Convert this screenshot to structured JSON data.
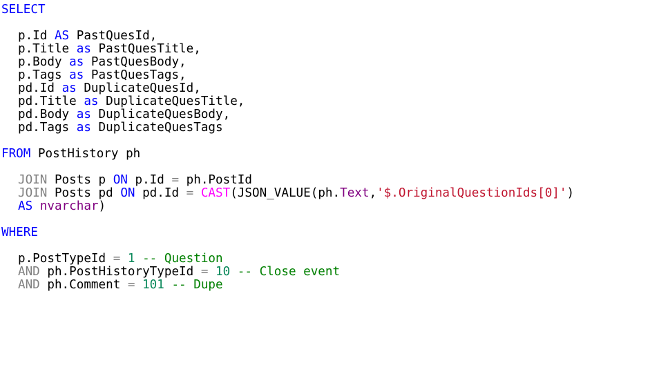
{
  "editor": {
    "lines": [
      [
        {
          "t": "SELECT",
          "c": "kw"
        }
      ],
      [],
      [
        {
          "t": "p.Id ",
          "c": "ident"
        },
        {
          "t": "AS",
          "c": "kw"
        },
        {
          "t": " PastQuesId,",
          "c": "ident"
        }
      ],
      [
        {
          "t": "p.Title ",
          "c": "ident"
        },
        {
          "t": "as",
          "c": "kw"
        },
        {
          "t": " PastQuesTitle,",
          "c": "ident"
        }
      ],
      [
        {
          "t": "p.Body ",
          "c": "ident"
        },
        {
          "t": "as",
          "c": "kw"
        },
        {
          "t": " PastQuesBody,",
          "c": "ident"
        }
      ],
      [
        {
          "t": "p.Tags ",
          "c": "ident"
        },
        {
          "t": "as",
          "c": "kw"
        },
        {
          "t": " PastQuesTags,",
          "c": "ident"
        }
      ],
      [
        {
          "t": "pd.Id ",
          "c": "ident"
        },
        {
          "t": "as",
          "c": "kw"
        },
        {
          "t": " DuplicateQuesId,",
          "c": "ident"
        }
      ],
      [
        {
          "t": "pd.Title ",
          "c": "ident"
        },
        {
          "t": "as",
          "c": "kw"
        },
        {
          "t": " DuplicateQuesTitle,",
          "c": "ident"
        }
      ],
      [
        {
          "t": "pd.Body ",
          "c": "ident"
        },
        {
          "t": "as",
          "c": "kw"
        },
        {
          "t": " DuplicateQuesBody,",
          "c": "ident"
        }
      ],
      [
        {
          "t": "pd.Tags ",
          "c": "ident"
        },
        {
          "t": "as",
          "c": "kw"
        },
        {
          "t": " DuplicateQuesTags",
          "c": "ident"
        }
      ],
      [],
      [
        {
          "t": "FROM",
          "c": "kw"
        },
        {
          "t": " PostHistory ph",
          "c": "ident"
        }
      ],
      [],
      [
        {
          "t": "JOIN",
          "c": "gray"
        },
        {
          "t": " Posts p ",
          "c": "ident"
        },
        {
          "t": "ON",
          "c": "kw"
        },
        {
          "t": " p.Id ",
          "c": "ident"
        },
        {
          "t": "=",
          "c": "gray"
        },
        {
          "t": " ph.PostId",
          "c": "ident"
        }
      ],
      [
        {
          "t": "JOIN",
          "c": "gray"
        },
        {
          "t": " Posts pd ",
          "c": "ident"
        },
        {
          "t": "ON",
          "c": "kw"
        },
        {
          "t": " pd.Id ",
          "c": "ident"
        },
        {
          "t": "=",
          "c": "gray"
        },
        {
          "t": " ",
          "c": "ident"
        },
        {
          "t": "CAST",
          "c": "magenta"
        },
        {
          "t": "(JSON_VALUE(ph.",
          "c": "ident"
        },
        {
          "t": "Text",
          "c": "purple"
        },
        {
          "t": ",",
          "c": "ident"
        },
        {
          "t": "'$.OriginalQuestionIds[0]'",
          "c": "red"
        },
        {
          "t": ")",
          "c": "ident"
        }
      ],
      [
        {
          "t": "AS",
          "c": "kw"
        },
        {
          "t": " ",
          "c": "ident"
        },
        {
          "t": "nvarchar",
          "c": "purple"
        },
        {
          "t": ")",
          "c": "ident"
        }
      ],
      [],
      [
        {
          "t": "WHERE",
          "c": "kw"
        }
      ],
      [],
      [
        {
          "t": "p.PostTypeId ",
          "c": "ident"
        },
        {
          "t": "=",
          "c": "gray"
        },
        {
          "t": " ",
          "c": "ident"
        },
        {
          "t": "1",
          "c": "num"
        },
        {
          "t": " -- Question",
          "c": "green"
        }
      ],
      [
        {
          "t": "AND",
          "c": "gray"
        },
        {
          "t": " ph.PostHistoryTypeId ",
          "c": "ident"
        },
        {
          "t": "=",
          "c": "gray"
        },
        {
          "t": " ",
          "c": "ident"
        },
        {
          "t": "10",
          "c": "num"
        },
        {
          "t": " -- Close event",
          "c": "green"
        }
      ],
      [
        {
          "t": "AND",
          "c": "gray"
        },
        {
          "t": " ph.Comment ",
          "c": "ident"
        },
        {
          "t": "=",
          "c": "gray"
        },
        {
          "t": " ",
          "c": "ident"
        },
        {
          "t": "101",
          "c": "num"
        },
        {
          "t": " -- Dupe",
          "c": "green"
        }
      ]
    ],
    "indented": [
      2,
      3,
      4,
      5,
      6,
      7,
      8,
      9,
      13,
      14,
      15,
      19,
      20,
      21
    ]
  }
}
